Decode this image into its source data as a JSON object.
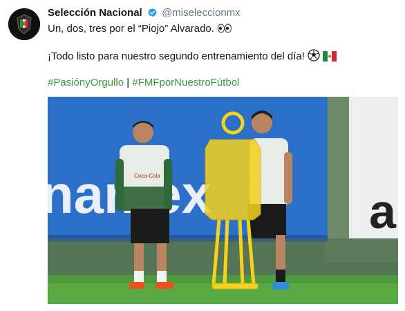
{
  "author": {
    "name": "Selección Nacional",
    "handle": "@miseleccionmx",
    "verified": true
  },
  "tweet": {
    "line1": "Un, dos, tres por el “Piojo” Alvarado.",
    "line2": "¡Todo listo para nuestro segundo entrenamiento del día!",
    "hashtags": [
      "#PasiónyOrgullo",
      "#FMFporNuestroFútbol"
    ],
    "separator": "|",
    "emojis": [
      "eyes-emoji",
      "soccer-ball-emoji",
      "mexico-flag-emoji"
    ]
  },
  "photo": {
    "banner_text": "namex",
    "shirt_text": "Coca-Cola"
  },
  "colors": {
    "hashtag": "#3a9a3a",
    "verified": "#1da1f2",
    "handle": "#657786",
    "banner": "#2b6fc8",
    "grass": "#4f9a3c",
    "dummy": "#f5d21e"
  }
}
